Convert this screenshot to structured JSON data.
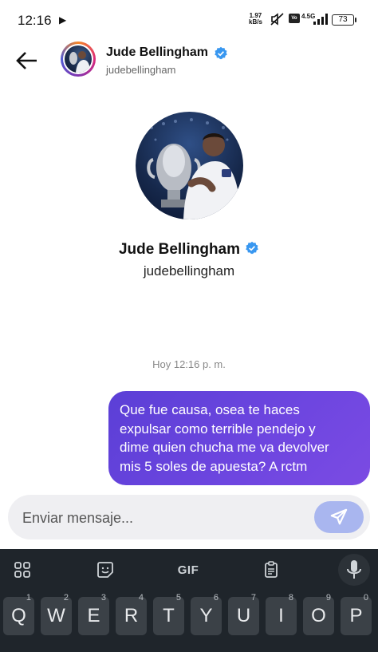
{
  "status_bar": {
    "time": "12:16",
    "net_speed_value": "1.97",
    "net_speed_unit": "kB/s",
    "volte": "Vo LTE",
    "net_type": "4.5G",
    "battery": "73"
  },
  "header": {
    "name": "Jude Bellingham",
    "handle": "judebellingham"
  },
  "profile": {
    "name": "Jude Bellingham",
    "handle": "judebellingham"
  },
  "conversation": {
    "timestamp": "Hoy 12:16 p. m.",
    "messages": [
      {
        "lines": [
          "Que fue causa, osea te haces",
          "expulsar como terrible pendejo y",
          "dime quien chucha me va devolver",
          "mis 5 soles de apuesta? A rctm"
        ]
      }
    ]
  },
  "composer": {
    "placeholder": "Enviar mensaje..."
  },
  "keyboard": {
    "gif_label": "GIF",
    "keys": [
      {
        "label": "Q",
        "hint": "1"
      },
      {
        "label": "W",
        "hint": "2"
      },
      {
        "label": "E",
        "hint": "3"
      },
      {
        "label": "R",
        "hint": "4"
      },
      {
        "label": "T",
        "hint": "5"
      },
      {
        "label": "Y",
        "hint": "6"
      },
      {
        "label": "U",
        "hint": "7"
      },
      {
        "label": "I",
        "hint": "8"
      },
      {
        "label": "O",
        "hint": "9"
      },
      {
        "label": "P",
        "hint": "0"
      }
    ]
  },
  "colors": {
    "accent": "#6e46e0",
    "verified": "#3897f0",
    "send_button": "#a9b6ef"
  }
}
